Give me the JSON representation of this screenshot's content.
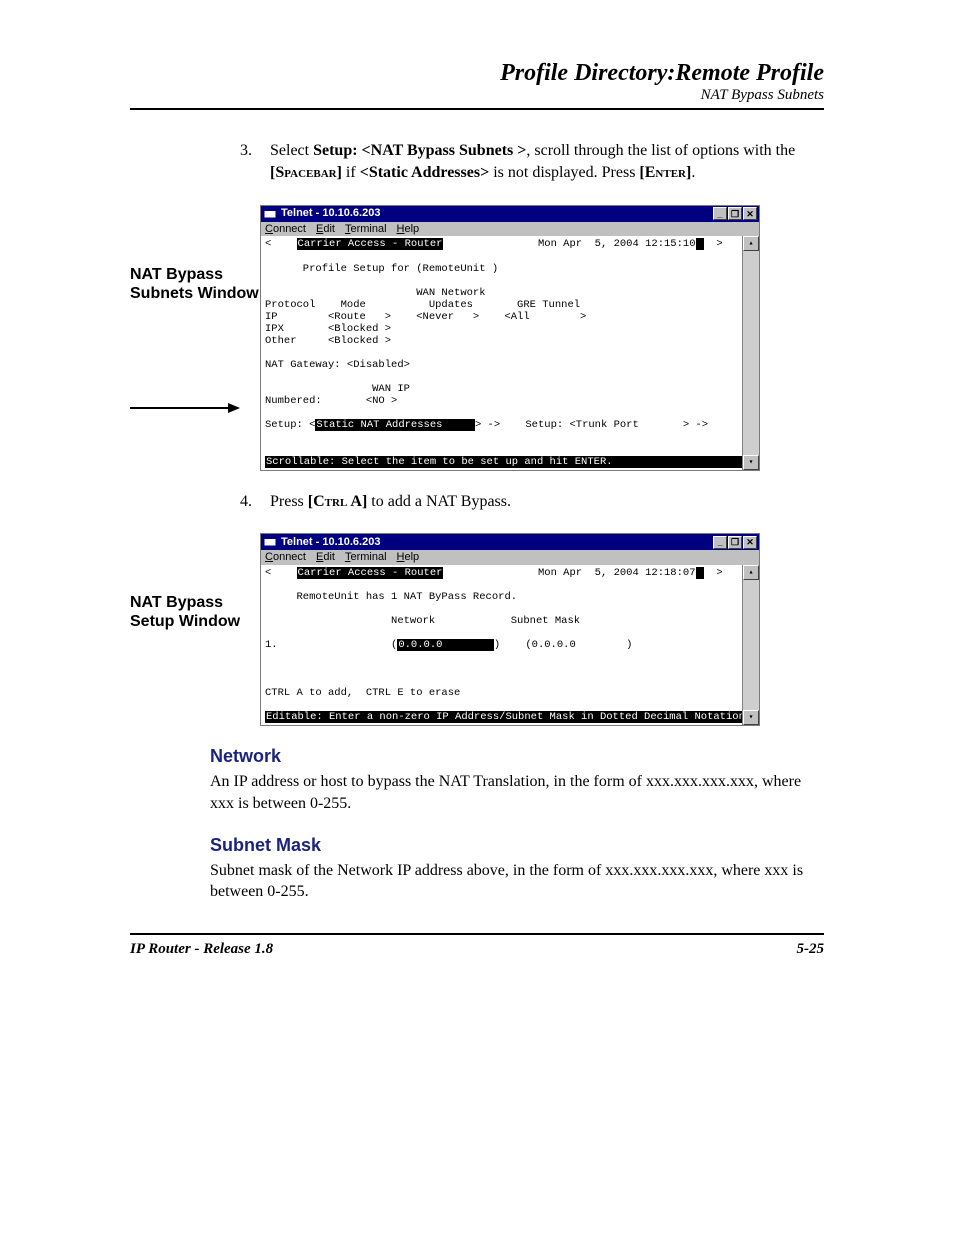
{
  "header": {
    "title": "Profile Directory:Remote Profile",
    "subtitle": "NAT Bypass Subnets"
  },
  "step3": {
    "num": "3.",
    "text_pre": "Select ",
    "bold1": "Setup: <NAT Bypass Subnets >",
    "text_mid1": ", scroll through the list of options with the ",
    "bold2_open": "[",
    "bold2_sc": "Spacebar",
    "bold2_close": "]",
    "text_mid2": " if ",
    "bold3": "<Static Addresses>",
    "text_mid3": " is not displayed. Press ",
    "bold4_open": "[",
    "bold4_sc": "Enter",
    "bold4_close": "]",
    "text_end": "."
  },
  "step4": {
    "num": "4.",
    "text_pre": "Press ",
    "bold_open": "[",
    "bold_sc": "Ctrl A",
    "bold_close": "]",
    "text_end": " to add a NAT Bypass."
  },
  "fig1": {
    "label": "NAT Bypass Subnets Window",
    "win_title": "Telnet - 10.10.6.203",
    "menu": {
      "connect": "Connect",
      "edit": "Edit",
      "terminal": "Terminal",
      "help": "Help"
    },
    "line_top_left": "<    ",
    "line_top_inv": "Carrier Access - Router",
    "line_top_right": "               Mon Apr  5, 2004 12:15:10",
    "line_top_caret": "  >",
    "l2": "      Profile Setup for (RemoteUnit )",
    "l3": "                        WAN Network",
    "l4": "Protocol    Mode          Updates       GRE Tunnel",
    "l5": "IP        <Route   >    <Never   >    <All        >",
    "l6": "IPX       <Blocked >",
    "l7": "Other     <Blocked >",
    "l8": "NAT Gateway: <Disabled>",
    "l9": "                 WAN IP",
    "l10": "Numbered:       <NO >",
    "l11_pre": "Setup: <",
    "l11_inv": "Static NAT Addresses     ",
    "l11_post": "> ->    Setup: <Trunk Port       > ->",
    "l12_inv": "Scrollable: Select the item to be set up and hit ENTER.                     "
  },
  "fig2": {
    "label": "NAT Bypass Setup Window",
    "win_title": "Telnet - 10.10.6.203",
    "menu": {
      "connect": "Connect",
      "edit": "Edit",
      "terminal": "Terminal",
      "help": "Help"
    },
    "line_top_left": "<    ",
    "line_top_inv": "Carrier Access - Router",
    "line_top_right": "               Mon Apr  5, 2004 12:18:07",
    "line_top_caret": "  >",
    "l2": "     RemoteUnit has 1 NAT ByPass Record.",
    "l3": "                    Network            Subnet Mask",
    "l4_pre": "1.                  (",
    "l4_inv": "0.0.0.0        ",
    "l4_post": ")    (0.0.0.0        )",
    "l5": "CTRL A to add,  CTRL E to erase",
    "l6_inv": "Editable: Enter a non-zero IP Address/Subnet Mask in Dotted Decimal Notation."
  },
  "sections": {
    "network_h": "Network",
    "network_p": "An IP address or host to bypass the NAT Translation, in the form of xxx.xxx.xxx.xxx, where xxx is between 0-255.",
    "subnet_h": "Subnet Mask",
    "subnet_p": "Subnet mask of the Network IP address above, in the form of xxx.xxx.xxx.xxx, where xxx is between 0-255."
  },
  "footer": {
    "left": "IP Router - Release 1.8",
    "right": "5-25"
  },
  "glyphs": {
    "min": "_",
    "max": "❐",
    "close": "✕",
    "up": "▴",
    "down": "▾"
  }
}
